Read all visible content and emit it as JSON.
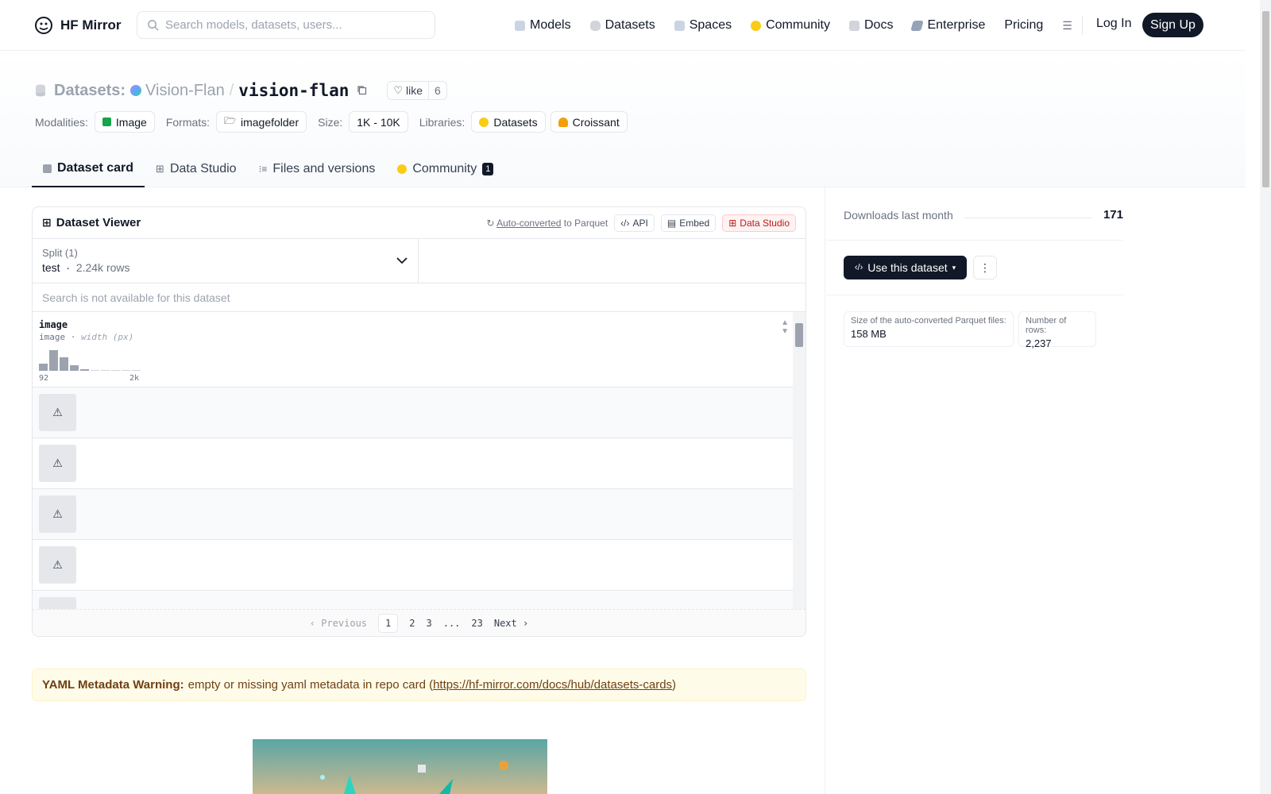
{
  "header": {
    "logo_text": "HF Mirror",
    "search_placeholder": "Search models, datasets, users...",
    "nav": [
      "Models",
      "Datasets",
      "Spaces",
      "Community",
      "Docs",
      "Enterprise",
      "Pricing"
    ],
    "login": "Log In",
    "signup": "Sign Up"
  },
  "repo": {
    "type_label": "Datasets:",
    "org": "Vision-Flan",
    "name": "vision-flan",
    "like_label": "like",
    "like_count": "6"
  },
  "tags": {
    "modalities_label": "Modalities:",
    "modality": "Image",
    "formats_label": "Formats:",
    "format": "imagefolder",
    "size_label": "Size:",
    "size": "1K - 10K",
    "libraries_label": "Libraries:",
    "lib1": "Datasets",
    "lib2": "Croissant"
  },
  "tabs": {
    "card": "Dataset card",
    "studio": "Data Studio",
    "files": "Files and versions",
    "community": "Community",
    "community_count": "1"
  },
  "viewer": {
    "title": "Dataset Viewer",
    "auto": "Auto-converted",
    "to_parquet": "to Parquet",
    "api": "API",
    "embed": "Embed",
    "studio": "Data Studio",
    "split_label": "Split (1)",
    "split_name": "test",
    "split_rows": "2.24k rows",
    "search_disabled": "Search is not available for this dataset",
    "column_name": "image",
    "column_type": "image",
    "column_sub": "width (px)",
    "hist_min": "92",
    "hist_max": "2k",
    "hist_values": [
      8,
      24,
      16,
      6,
      2,
      1,
      1,
      1,
      1,
      1
    ],
    "row_icon": "⚠",
    "pager": {
      "prev": "Previous",
      "pages": [
        "1",
        "2",
        "3",
        "...",
        "23"
      ],
      "next": "Next"
    }
  },
  "warning": {
    "bold": "YAML Metadata Warning:",
    "text": "empty or missing yaml metadata in repo card (",
    "link": "https://hf-mirror.com/docs/hub/datasets-cards",
    "close": ")"
  },
  "sidebar": {
    "downloads_label": "Downloads last month",
    "downloads": "171",
    "use_button": "Use this dataset",
    "parquet_size_label": "Size of the auto-converted Parquet files:",
    "parquet_size": "158 MB",
    "rows_label": "Number of rows:",
    "rows": "2,237"
  }
}
